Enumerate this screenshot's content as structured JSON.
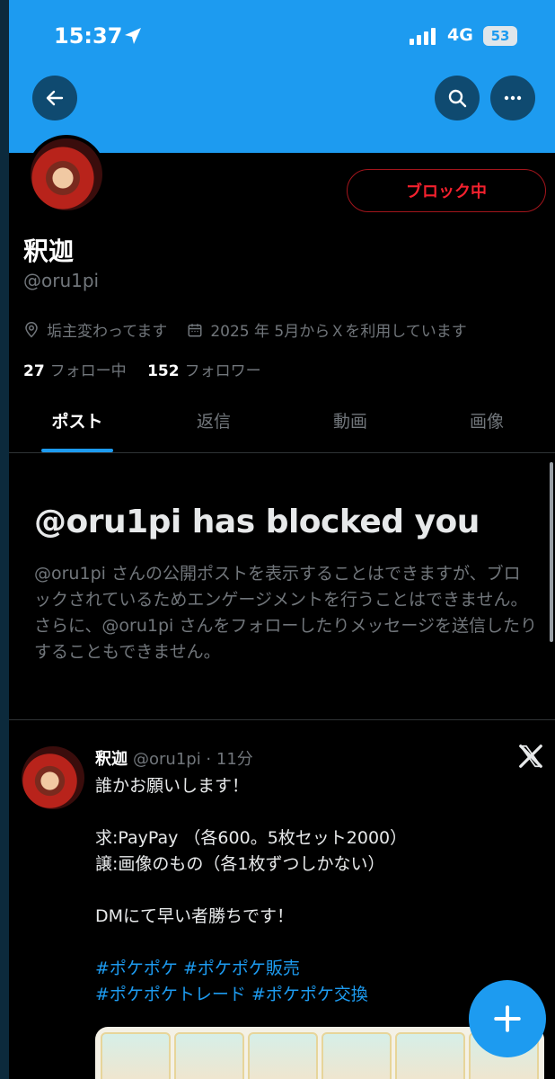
{
  "status_bar": {
    "time": "15:37",
    "network": "4G",
    "battery": "53"
  },
  "profile": {
    "name": "釈迦",
    "handle": "@oru1pi",
    "block_label": "ブロック中",
    "location": "垢主変わってます",
    "joined": "2025 年 5月からＸを利用しています",
    "following_count": "27",
    "following_label": "フォロー中",
    "followers_count": "152",
    "followers_label": "フォロワー"
  },
  "tabs": [
    {
      "label": "ポスト"
    },
    {
      "label": "返信"
    },
    {
      "label": "動画"
    },
    {
      "label": "画像"
    }
  ],
  "blocked": {
    "title": "@oru1pi has blocked you",
    "message": "@oru1pi さんの公開ポストを表示することはできますが、ブロックされているためエンゲージメントを行うことはできません。さらに、@oru1pi さんをフォローしたりメッセージを送信したりすることもできません。"
  },
  "tweet": {
    "author": "釈迦",
    "meta": "@oru1pi · 11分",
    "lines": [
      "誰かお願いします！",
      "",
      "求:PayPay （各600。5枚セット2000）",
      "譲:画像のもの（各1枚ずつしかない）",
      "",
      "DMにて早い者勝ちです！",
      ""
    ],
    "hashtags_line1": "#ポケポケ #ポケポケ販売",
    "hashtags_line2": "#ポケポケトレード #ポケポケ交換"
  },
  "icons": {
    "back": "arrow-left-icon",
    "search": "search-icon",
    "more": "more-dots-icon",
    "location": "location-pin-icon",
    "calendar": "calendar-icon",
    "x_logo": "x-logo-icon",
    "compose": "plus-icon"
  },
  "colors": {
    "accent": "#1d9bf0",
    "danger": "#f4212e",
    "background": "#000000",
    "muted": "#71767b"
  }
}
